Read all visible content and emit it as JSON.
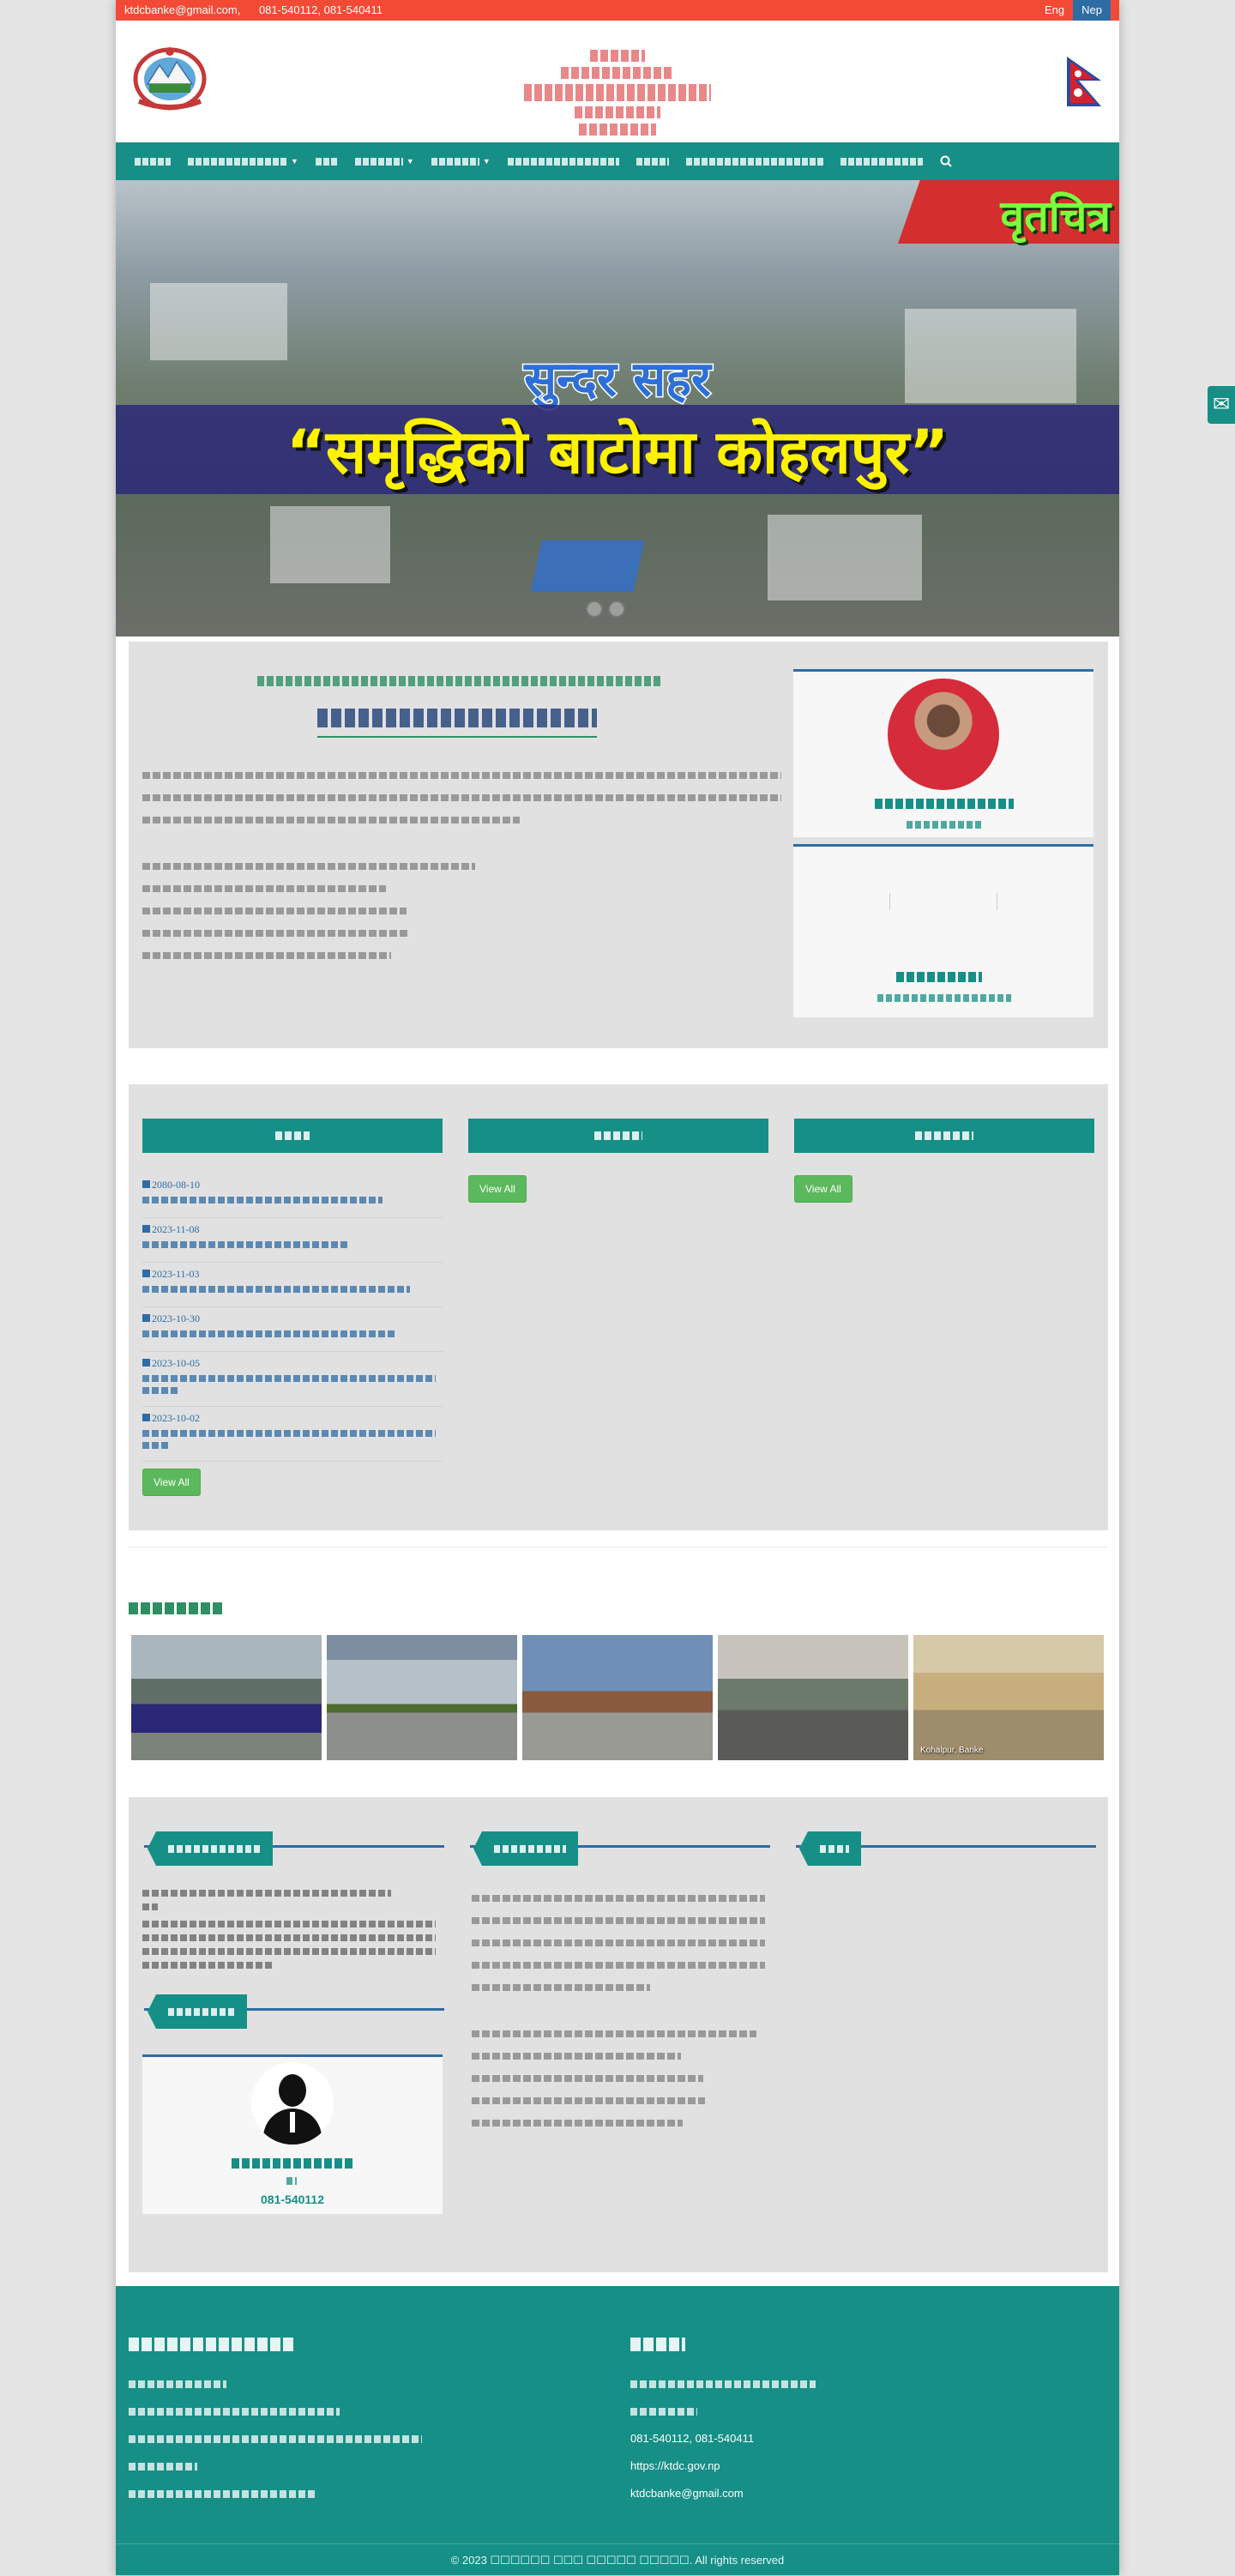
{
  "topbar": {
    "email": "ktdcbanke@gmail.com,",
    "phone": "081-540112, 081-540411",
    "lang_en": "Eng",
    "lang_np": "Nep"
  },
  "header": {
    "line1": "",
    "line2": "",
    "office_name": "",
    "line4": "",
    "line5": ""
  },
  "nav": {
    "items": [
      {
        "label": "",
        "caret": false
      },
      {
        "label": "",
        "caret": true
      },
      {
        "label": "",
        "caret": false
      },
      {
        "label": "",
        "caret": true
      },
      {
        "label": "",
        "caret": true
      },
      {
        "label": "",
        "caret": false
      },
      {
        "label": "",
        "caret": false
      },
      {
        "label": "",
        "caret": false
      },
      {
        "label": "",
        "caret": false
      }
    ],
    "search_icon": "search-icon"
  },
  "banner": {
    "ribbon": "वृतचित्र",
    "subtitle": "सुन्दर सहर",
    "title": "“समृद्धिको बाटोमा कोहलपुर”"
  },
  "news": {
    "notices_heading": "",
    "col2_heading": "",
    "col3_heading": "",
    "notices": [
      {
        "date": "2080-08-10",
        "title": ""
      },
      {
        "date": "2023-11-08",
        "title": ""
      },
      {
        "date": "2023-11-03",
        "title": ""
      },
      {
        "date": "2023-10-30",
        "title": ""
      },
      {
        "date": "2023-10-05",
        "title": ""
      },
      {
        "date": "2023-10-02",
        "title": ""
      }
    ],
    "view_all": "View All"
  },
  "gallery": {
    "thumb5_caption": "Kohalpur, Banke"
  },
  "officer": {
    "phone": "081-540112"
  },
  "footer": {
    "contact_phone": "081-540112, 081-540411",
    "contact_web": "https://ktdc.gov.np",
    "contact_email": "ktdcbanke@gmail.com",
    "copyright": "© 2023 ☐☐☐☐☐☐ ☐☐☐ ☐☐☐☐☐ ☐☐☐☐☐. All rights reserved"
  },
  "colors": {
    "topbar": "#f34a36",
    "teal": "#168f87",
    "blue": "#2e6ca4",
    "green_button": "#5cb85c"
  }
}
